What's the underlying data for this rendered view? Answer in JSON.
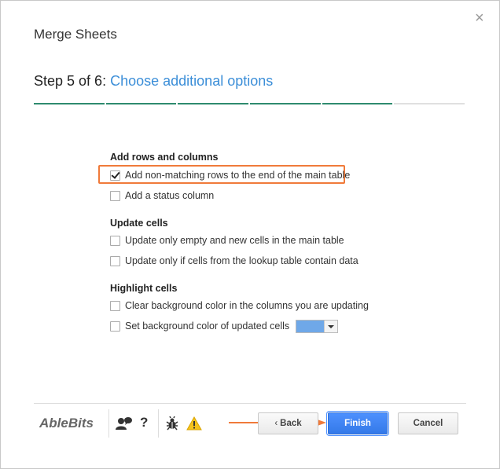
{
  "dialog": {
    "title": "Merge Sheets",
    "close_glyph": "×",
    "step_prefix": "Step 5 of 6:",
    "step_title": "Choose additional options",
    "progress": {
      "total_steps": 6,
      "completed_steps": 5,
      "colors": {
        "done": "#2e8b6e",
        "pending": "#e0e0e0"
      }
    }
  },
  "sections": {
    "add": {
      "heading": "Add rows and columns",
      "options": [
        {
          "label": "Add non-matching rows to the end of the main table",
          "checked": true
        },
        {
          "label": "Add a status column",
          "checked": false
        }
      ]
    },
    "update": {
      "heading": "Update cells",
      "options": [
        {
          "label": "Update only empty and new cells in the main table",
          "checked": false
        },
        {
          "label": "Update only if cells from the lookup table contain data",
          "checked": false
        }
      ]
    },
    "highlight": {
      "heading": "Highlight cells",
      "options": [
        {
          "label": "Clear background color in the columns you are updating",
          "checked": false
        },
        {
          "label": "Set background color of updated cells",
          "checked": false
        }
      ],
      "swatch_color": "#6fa8e8"
    }
  },
  "footer": {
    "logo": "AbleBits",
    "icons": [
      "support-icon",
      "help-icon",
      "bug-icon",
      "warning-icon"
    ],
    "help_glyph": "?",
    "back_label": "Back",
    "back_glyph": "‹",
    "finish_label": "Finish",
    "cancel_label": "Cancel"
  },
  "colors": {
    "accent": "#3b8ed8",
    "annotation": "#f07a3a",
    "primary_button": "#4d90fe"
  }
}
